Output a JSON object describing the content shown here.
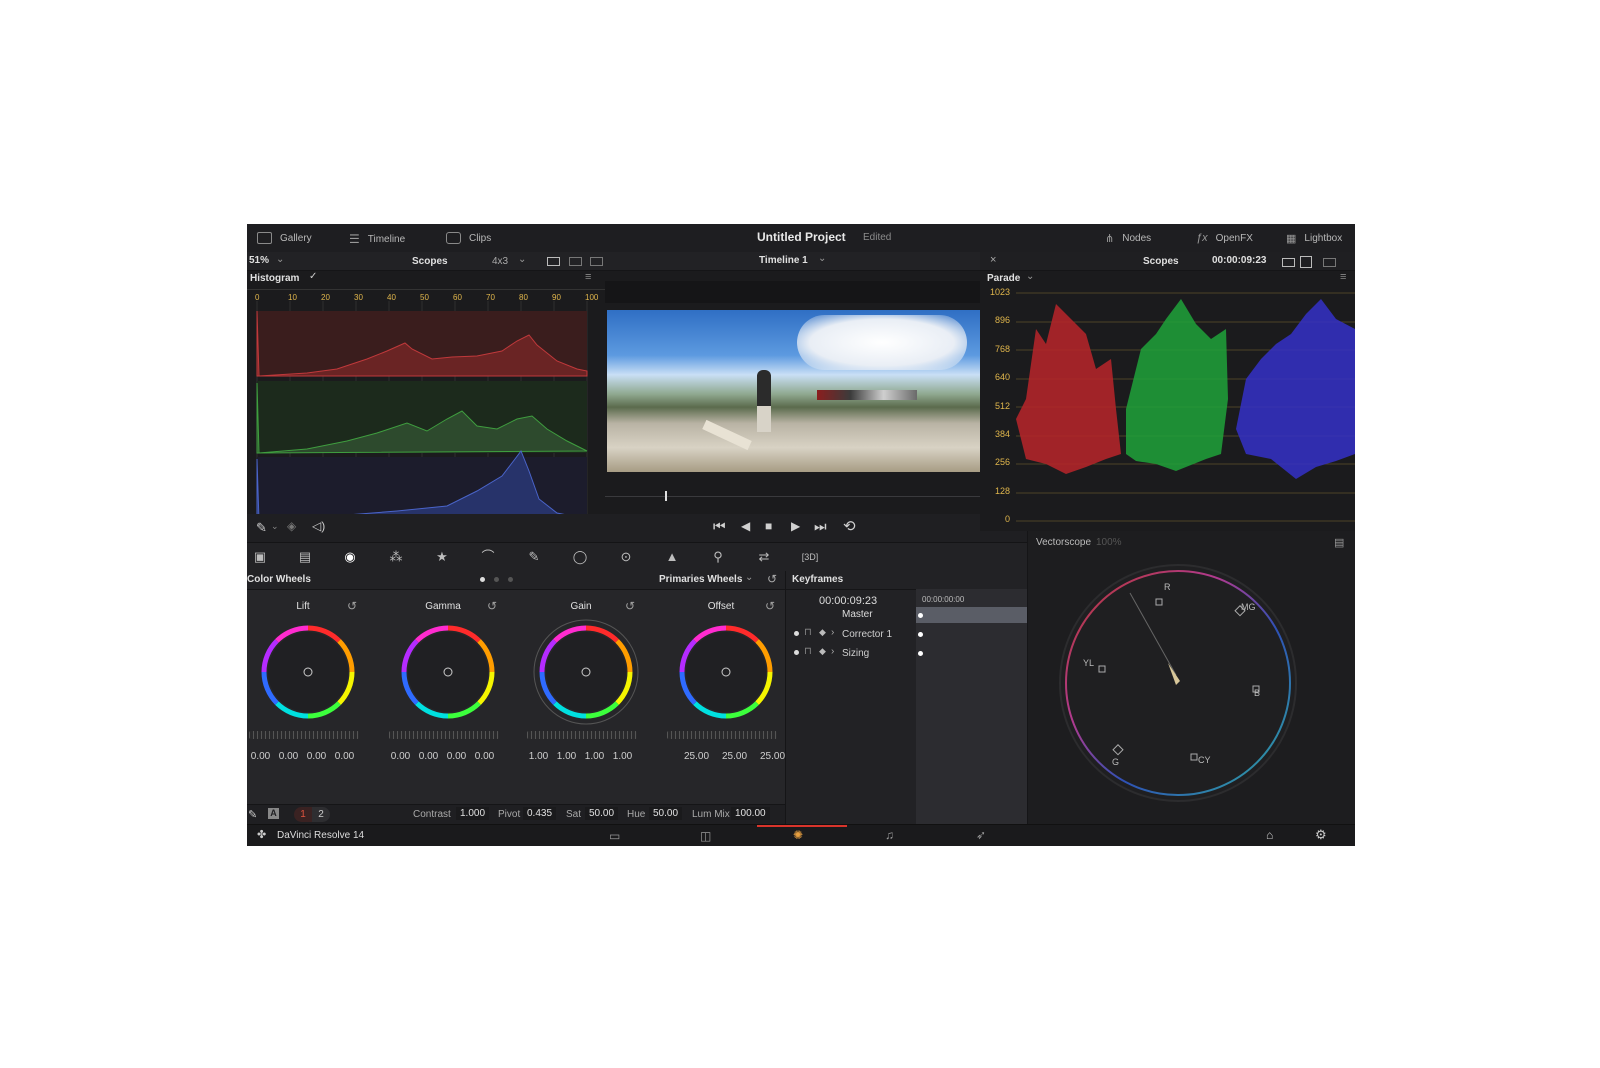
{
  "topbar": {
    "gallery_label": "Gallery",
    "timeline_label": "Timeline",
    "clips_label": "Clips",
    "project_title": "Untitled Project",
    "edited_label": "Edited",
    "nodes_label": "Nodes",
    "openfx_label": "OpenFX",
    "lightbox_label": "Lightbox"
  },
  "viewer_header": {
    "zoom": "51%",
    "scopes_label": "Scopes",
    "grid_label": "4x3",
    "timeline_name": "Timeline 1"
  },
  "histogram": {
    "title": "Histogram",
    "x_ticks": [
      "0",
      "10",
      "20",
      "30",
      "40",
      "50",
      "60",
      "70",
      "80",
      "90",
      "100"
    ]
  },
  "right_scopes": {
    "scopes_label": "Scopes",
    "timecode": "00:00:09:23",
    "parade_label": "Parade",
    "y_ticks": [
      "1023",
      "896",
      "768",
      "640",
      "512",
      "384",
      "256",
      "128",
      "0"
    ]
  },
  "vectorscope": {
    "title": "Vectorscope",
    "zoom": "100%",
    "targets": [
      "R",
      "MG",
      "YL",
      "B",
      "G",
      "CY"
    ]
  },
  "color_wheels": {
    "panel_title": "Color Wheels",
    "mode_label": "Primaries Wheels",
    "wheels": [
      {
        "name": "Lift",
        "values": [
          "0.00",
          "0.00",
          "0.00",
          "0.00"
        ]
      },
      {
        "name": "Gamma",
        "values": [
          "0.00",
          "0.00",
          "0.00",
          "0.00"
        ]
      },
      {
        "name": "Gain",
        "values": [
          "1.00",
          "1.00",
          "1.00",
          "1.00"
        ]
      },
      {
        "name": "Offset",
        "values": [
          "25.00",
          "25.00",
          "25.00"
        ]
      }
    ]
  },
  "bottom_params": {
    "page_1": "1",
    "page_2": "2",
    "contrast_label": "Contrast",
    "contrast_value": "1.000",
    "pivot_label": "Pivot",
    "pivot_value": "0.435",
    "sat_label": "Sat",
    "sat_value": "50.00",
    "hue_label": "Hue",
    "hue_value": "50.00",
    "lummix_label": "Lum Mix",
    "lummix_value": "100.00"
  },
  "keyframes": {
    "title": "Keyframes",
    "current_timecode": "00:00:09:23",
    "ruler_timecode": "00:00:00:00",
    "rows": [
      "Master",
      "Corrector 1",
      "Sizing"
    ]
  },
  "statusbar": {
    "app_name": "DaVinci Resolve 14"
  },
  "colors": {
    "accent_red": "#d9342b",
    "scope_yellow": "#e0b64c",
    "panel_bg": "#28282b"
  }
}
